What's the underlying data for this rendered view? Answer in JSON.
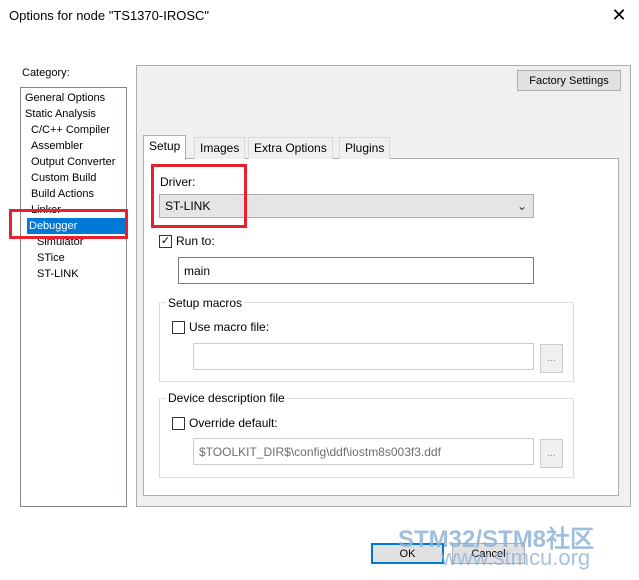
{
  "window": {
    "title": "Options for node \"TS1370-IROSC\"",
    "close_label": "✕"
  },
  "sidebar": {
    "label": "Category:",
    "items": [
      {
        "label": "General Options",
        "selected": false
      },
      {
        "label": "Static Analysis",
        "selected": false
      },
      {
        "label": "C/C++ Compiler",
        "selected": false
      },
      {
        "label": "Assembler",
        "selected": false
      },
      {
        "label": "Output Converter",
        "selected": false
      },
      {
        "label": "Custom Build",
        "selected": false
      },
      {
        "label": "Build Actions",
        "selected": false
      },
      {
        "label": "Linker",
        "selected": false
      },
      {
        "label": "Debugger",
        "selected": true
      },
      {
        "label": "Simulator",
        "selected": false
      },
      {
        "label": "STice",
        "selected": false
      },
      {
        "label": "ST-LINK",
        "selected": false
      }
    ]
  },
  "main": {
    "factory_settings_label": "Factory Settings",
    "tabs": [
      {
        "label": "Setup",
        "active": true
      },
      {
        "label": "Images",
        "active": false
      },
      {
        "label": "Extra Options",
        "active": false
      },
      {
        "label": "Plugins",
        "active": false
      }
    ],
    "driver": {
      "label": "Driver:",
      "value": "ST-LINK",
      "arrow": "⌄"
    },
    "run_to": {
      "label": "Run to:",
      "checked": true,
      "check_mark": "✓",
      "value": "main"
    },
    "setup_macros": {
      "title": "Setup macros",
      "use_macro_label": "Use macro file:",
      "checked": false,
      "value": "",
      "browse_label": "..."
    },
    "device_description": {
      "title": "Device description file",
      "override_label": "Override default:",
      "checked": false,
      "value": "$TOOLKIT_DIR$\\config\\ddf\\iostm8s003f3.ddf",
      "browse_label": "..."
    }
  },
  "footer": {
    "ok_label": "OK",
    "cancel_label": "Cancel"
  },
  "watermark": {
    "line1": "STM32/STM8社区",
    "line2": "www.stmcu.org"
  },
  "colors": {
    "selection": "#0078d7",
    "highlight_box": "#e8212e",
    "panel": "#f0f0f0"
  }
}
